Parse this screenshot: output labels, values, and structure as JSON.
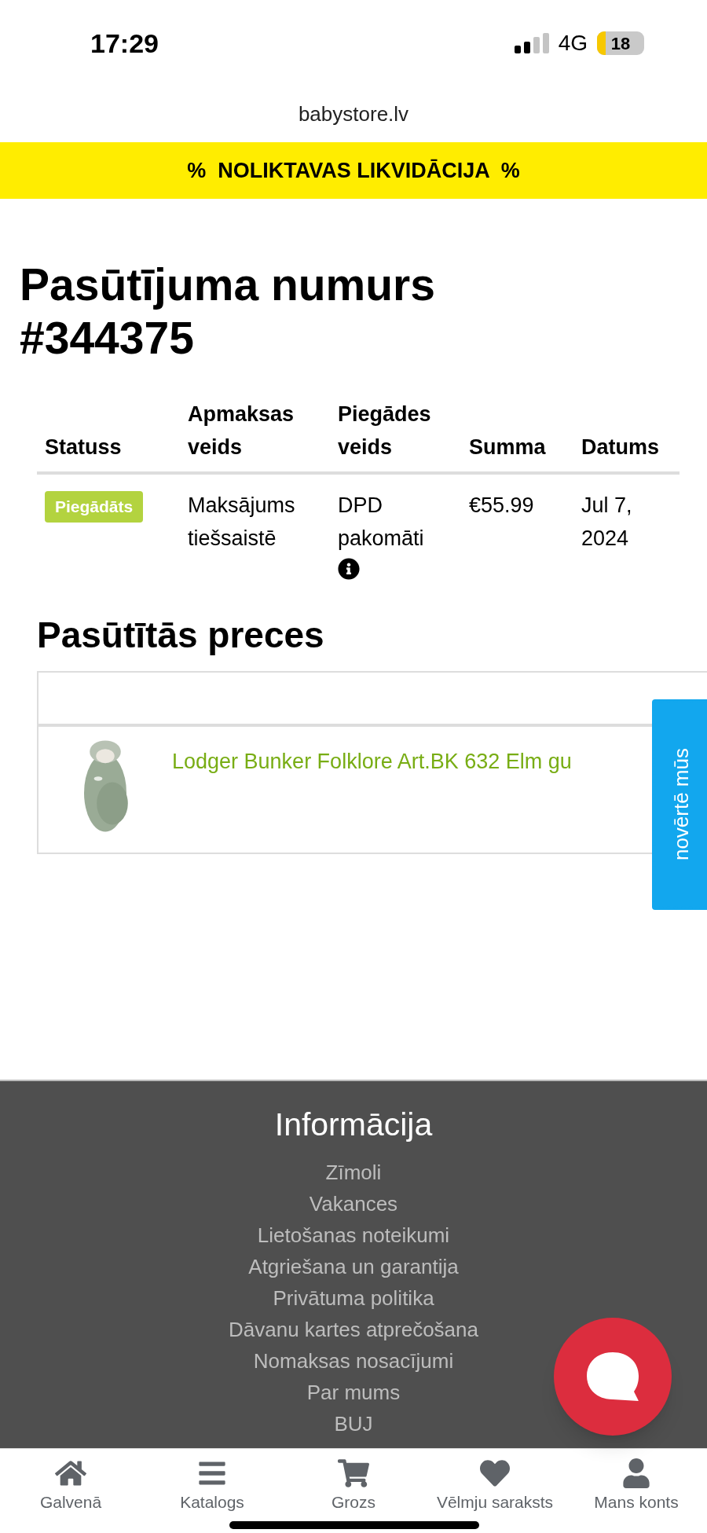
{
  "status_bar": {
    "time": "17:29",
    "network": "4G",
    "battery": "18"
  },
  "address_bar": {
    "url": "babystore.lv"
  },
  "banner": {
    "text": "%  NOLIKTAVAS LIKVIDĀCIJA  %"
  },
  "order": {
    "title": "Pasūtījuma numurs #344375",
    "columns": [
      "Statuss",
      "Apmaksas veids",
      "Piegādes veids",
      "Summa",
      "Datums"
    ],
    "rows": [
      {
        "status": "Piegādāts",
        "payment": "Maksājums tiešsaistē",
        "delivery": "DPD pakomāti",
        "sum": "€55.99",
        "date": "Jul 7, 2024"
      }
    ]
  },
  "ordered_items": {
    "heading": "Pasūtītās preces",
    "items": [
      {
        "name": "Lodger Bunker Folklore Art.BK 632 Elm gu"
      }
    ]
  },
  "rate_tab": {
    "label": "novērtē mūs"
  },
  "footer": {
    "heading": "Informācija",
    "links": [
      "Zīmoli",
      "Vakances",
      "Lietošanas noteikumi",
      "Atgriešana un garantija",
      "Privātuma politika",
      "Dāvanu kartes atprečošana",
      "Nomaksas nosacījumi",
      "Par mums",
      "BUJ"
    ]
  },
  "bottom_nav": {
    "items": [
      {
        "kind": "home",
        "label": "Galvenā"
      },
      {
        "kind": "catalog",
        "label": "Katalogs"
      },
      {
        "kind": "cart",
        "label": "Grozs"
      },
      {
        "kind": "wishlist",
        "label": "Vēlmju saraksts"
      },
      {
        "kind": "account",
        "label": "Mans konts"
      }
    ]
  }
}
